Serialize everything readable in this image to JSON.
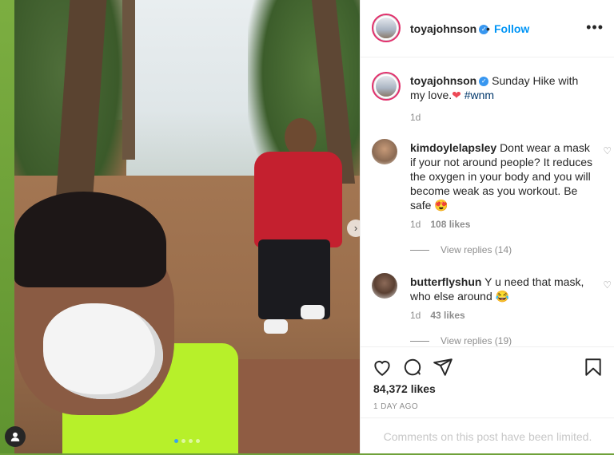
{
  "post": {
    "author": "toyajohnson",
    "follow_label": "Follow",
    "separator": "•",
    "more_label": "•••",
    "caption_text": "Sunday Hike with my love.",
    "caption_heart": "❤",
    "caption_tag": "#wnm",
    "caption_age": "1d",
    "likes": "84,372 likes",
    "age": "1 DAY AGO",
    "comments_limited": "Comments on this post have been limited.",
    "carousel": {
      "slides": 4,
      "active_index": 0,
      "next_icon": "›"
    }
  },
  "comments": [
    {
      "username": "kimdoylelapsley",
      "text": "Dont wear a mask if your not around people? It reduces the oxygen in your body and you will become weak as you workout. Be safe",
      "emoji": "😍",
      "age": "1d",
      "likes": "108 likes",
      "replies": "View replies (14)"
    },
    {
      "username": "butterflyshun",
      "text": "Y u need that mask, who else around",
      "emoji": "😂",
      "age": "1d",
      "likes": "43 likes",
      "replies": "View replies (19)"
    }
  ],
  "icons": {
    "like": "heart-icon",
    "comment": "comment-icon",
    "share": "share-icon",
    "save": "bookmark-icon",
    "user_tag": "person-icon"
  },
  "colors": {
    "link_blue": "#0095f6",
    "verified_blue": "#3897f0",
    "heart_red": "#ed4956",
    "text": "#262626",
    "muted": "#8e8e8e"
  }
}
